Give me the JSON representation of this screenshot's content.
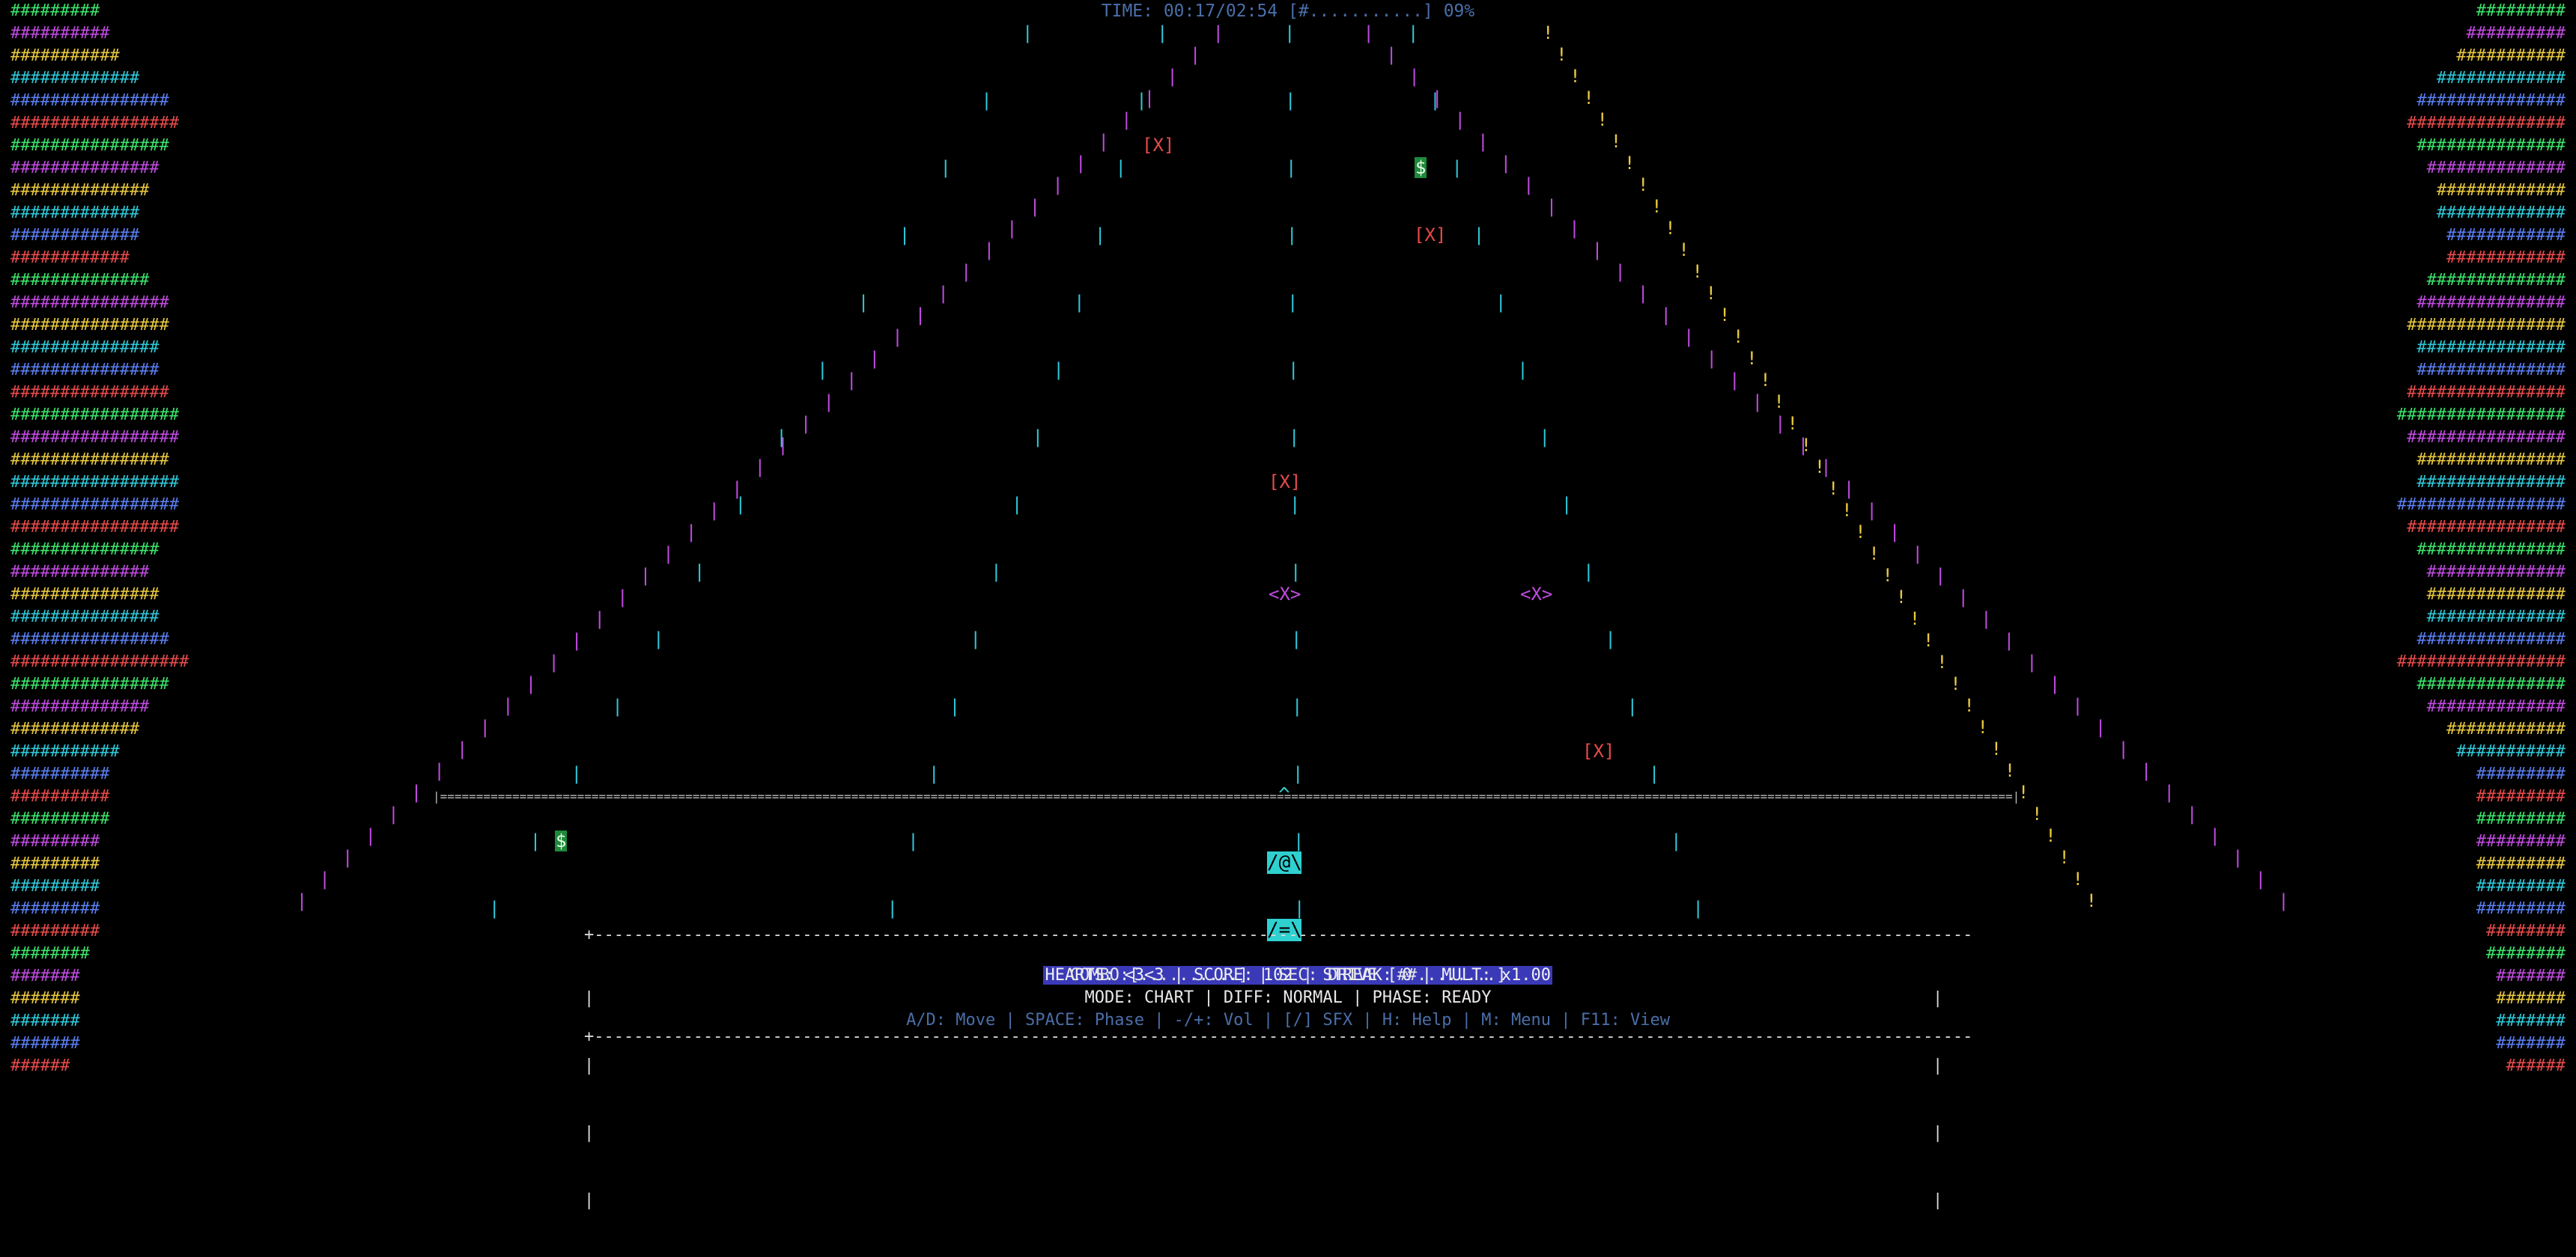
{
  "colors": {
    "background": "#000000",
    "green": "#3be36a",
    "magenta": "#c04be0",
    "yellow": "#e8c840",
    "cyan": "#2fc8d8",
    "blue": "#5a7ef0",
    "red": "#e84a4a",
    "dim_text": "#4a6ea8",
    "bright_text": "#e8e8e8",
    "highlight_bg": "#3a3ab8",
    "player": "#2fd0d0",
    "pickup_bg": "#1e8a3a"
  },
  "header": {
    "status": "TIME: 00:17/02:54 [#...........] 09%"
  },
  "side_bars": {
    "left": [
      {
        "text": "#########",
        "color": "green"
      },
      {
        "text": "##########",
        "color": "magenta"
      },
      {
        "text": "###########",
        "color": "yellow"
      },
      {
        "text": "#############",
        "color": "cyan"
      },
      {
        "text": "################",
        "color": "blue"
      },
      {
        "text": "#################",
        "color": "red"
      },
      {
        "text": "################",
        "color": "green"
      },
      {
        "text": "###############",
        "color": "magenta"
      },
      {
        "text": "##############",
        "color": "yellow"
      },
      {
        "text": "#############",
        "color": "cyan"
      },
      {
        "text": "#############",
        "color": "blue"
      },
      {
        "text": "############",
        "color": "red"
      },
      {
        "text": "##############",
        "color": "green"
      },
      {
        "text": "################",
        "color": "magenta"
      },
      {
        "text": "################",
        "color": "yellow"
      },
      {
        "text": "###############",
        "color": "cyan"
      },
      {
        "text": "###############",
        "color": "blue"
      },
      {
        "text": "################",
        "color": "red"
      },
      {
        "text": "#################",
        "color": "green"
      },
      {
        "text": "#################",
        "color": "magenta"
      },
      {
        "text": "################",
        "color": "yellow"
      },
      {
        "text": "#################",
        "color": "cyan"
      },
      {
        "text": "#################",
        "color": "blue"
      },
      {
        "text": "#################",
        "color": "red"
      },
      {
        "text": "###############",
        "color": "green"
      },
      {
        "text": "##############",
        "color": "magenta"
      },
      {
        "text": "###############",
        "color": "yellow"
      },
      {
        "text": "###############",
        "color": "cyan"
      },
      {
        "text": "################",
        "color": "blue"
      },
      {
        "text": "##################",
        "color": "red"
      },
      {
        "text": "################",
        "color": "green"
      },
      {
        "text": "##############",
        "color": "magenta"
      },
      {
        "text": "#############",
        "color": "yellow"
      },
      {
        "text": "###########",
        "color": "cyan"
      },
      {
        "text": "##########",
        "color": "blue"
      },
      {
        "text": "##########",
        "color": "red"
      },
      {
        "text": "##########",
        "color": "green"
      },
      {
        "text": "#########",
        "color": "magenta"
      },
      {
        "text": "#########",
        "color": "yellow"
      },
      {
        "text": "#########",
        "color": "cyan"
      },
      {
        "text": "#########",
        "color": "blue"
      },
      {
        "text": "#########",
        "color": "red"
      },
      {
        "text": "########",
        "color": "green"
      },
      {
        "text": "#######",
        "color": "magenta"
      },
      {
        "text": "#######",
        "color": "yellow"
      },
      {
        "text": "#######",
        "color": "cyan"
      },
      {
        "text": "#######",
        "color": "blue"
      },
      {
        "text": "######",
        "color": "red"
      }
    ],
    "right": [
      {
        "text": "#########",
        "color": "green"
      },
      {
        "text": "##########",
        "color": "magenta"
      },
      {
        "text": "###########",
        "color": "yellow"
      },
      {
        "text": "#############",
        "color": "cyan"
      },
      {
        "text": "###############",
        "color": "blue"
      },
      {
        "text": "################",
        "color": "red"
      },
      {
        "text": "###############",
        "color": "green"
      },
      {
        "text": "##############",
        "color": "magenta"
      },
      {
        "text": "#############",
        "color": "yellow"
      },
      {
        "text": "#############",
        "color": "cyan"
      },
      {
        "text": "############",
        "color": "blue"
      },
      {
        "text": "############",
        "color": "red"
      },
      {
        "text": "##############",
        "color": "green"
      },
      {
        "text": "###############",
        "color": "magenta"
      },
      {
        "text": "################",
        "color": "yellow"
      },
      {
        "text": "###############",
        "color": "cyan"
      },
      {
        "text": "###############",
        "color": "blue"
      },
      {
        "text": "################",
        "color": "red"
      },
      {
        "text": "#################",
        "color": "green"
      },
      {
        "text": "################",
        "color": "magenta"
      },
      {
        "text": "###############",
        "color": "yellow"
      },
      {
        "text": "###############",
        "color": "cyan"
      },
      {
        "text": "#################",
        "color": "blue"
      },
      {
        "text": "################",
        "color": "red"
      },
      {
        "text": "###############",
        "color": "green"
      },
      {
        "text": "##############",
        "color": "magenta"
      },
      {
        "text": "##############",
        "color": "yellow"
      },
      {
        "text": "##############",
        "color": "cyan"
      },
      {
        "text": "###############",
        "color": "blue"
      },
      {
        "text": "#################",
        "color": "red"
      },
      {
        "text": "###############",
        "color": "green"
      },
      {
        "text": "##############",
        "color": "magenta"
      },
      {
        "text": "############",
        "color": "yellow"
      },
      {
        "text": "###########",
        "color": "cyan"
      },
      {
        "text": "#########",
        "color": "blue"
      },
      {
        "text": "#########",
        "color": "red"
      },
      {
        "text": "#########",
        "color": "green"
      },
      {
        "text": "#########",
        "color": "magenta"
      },
      {
        "text": "#########",
        "color": "yellow"
      },
      {
        "text": "#########",
        "color": "cyan"
      },
      {
        "text": "#########",
        "color": "blue"
      },
      {
        "text": "########",
        "color": "red"
      },
      {
        "text": "########",
        "color": "green"
      },
      {
        "text": "#######",
        "color": "magenta"
      },
      {
        "text": "#######",
        "color": "yellow"
      },
      {
        "text": "#######",
        "color": "cyan"
      },
      {
        "text": "#######",
        "color": "blue"
      },
      {
        "text": "######",
        "color": "red"
      }
    ]
  },
  "track": {
    "left_edge_glyph": "|",
    "right_edge_glyph": "|",
    "right_warning_glyph": "!",
    "lane_glyph": "|",
    "hit_line": "|==========================================================================================================================================================================================================================|"
  },
  "objects": {
    "obstacle_label": "[X]",
    "enemy_label": "<X>",
    "pickup_label": "$"
  },
  "player": {
    "line1": "^",
    "line2": "/@\\",
    "line3": "/=\\"
  },
  "hud": {
    "frame_top": "+------------------------------------------------------------------------------------------------------------------------------------------------------------------------------------------------------------------------------------+",
    "frame_side": "|",
    "stats": "HEARTS: <3<3 | SCORE: 102 | STREAK: 0 | MULT: x1.00",
    "combo": "COMBO:[..........] | SEC: DRIVE [##........]",
    "mode": "MODE: CHART | DIFF: NORMAL | PHASE: READY",
    "controls": "A/D: Move | SPACE: Phase | -/+: Vol | [/] SFX | H: Help | M: Menu | F11: View"
  }
}
